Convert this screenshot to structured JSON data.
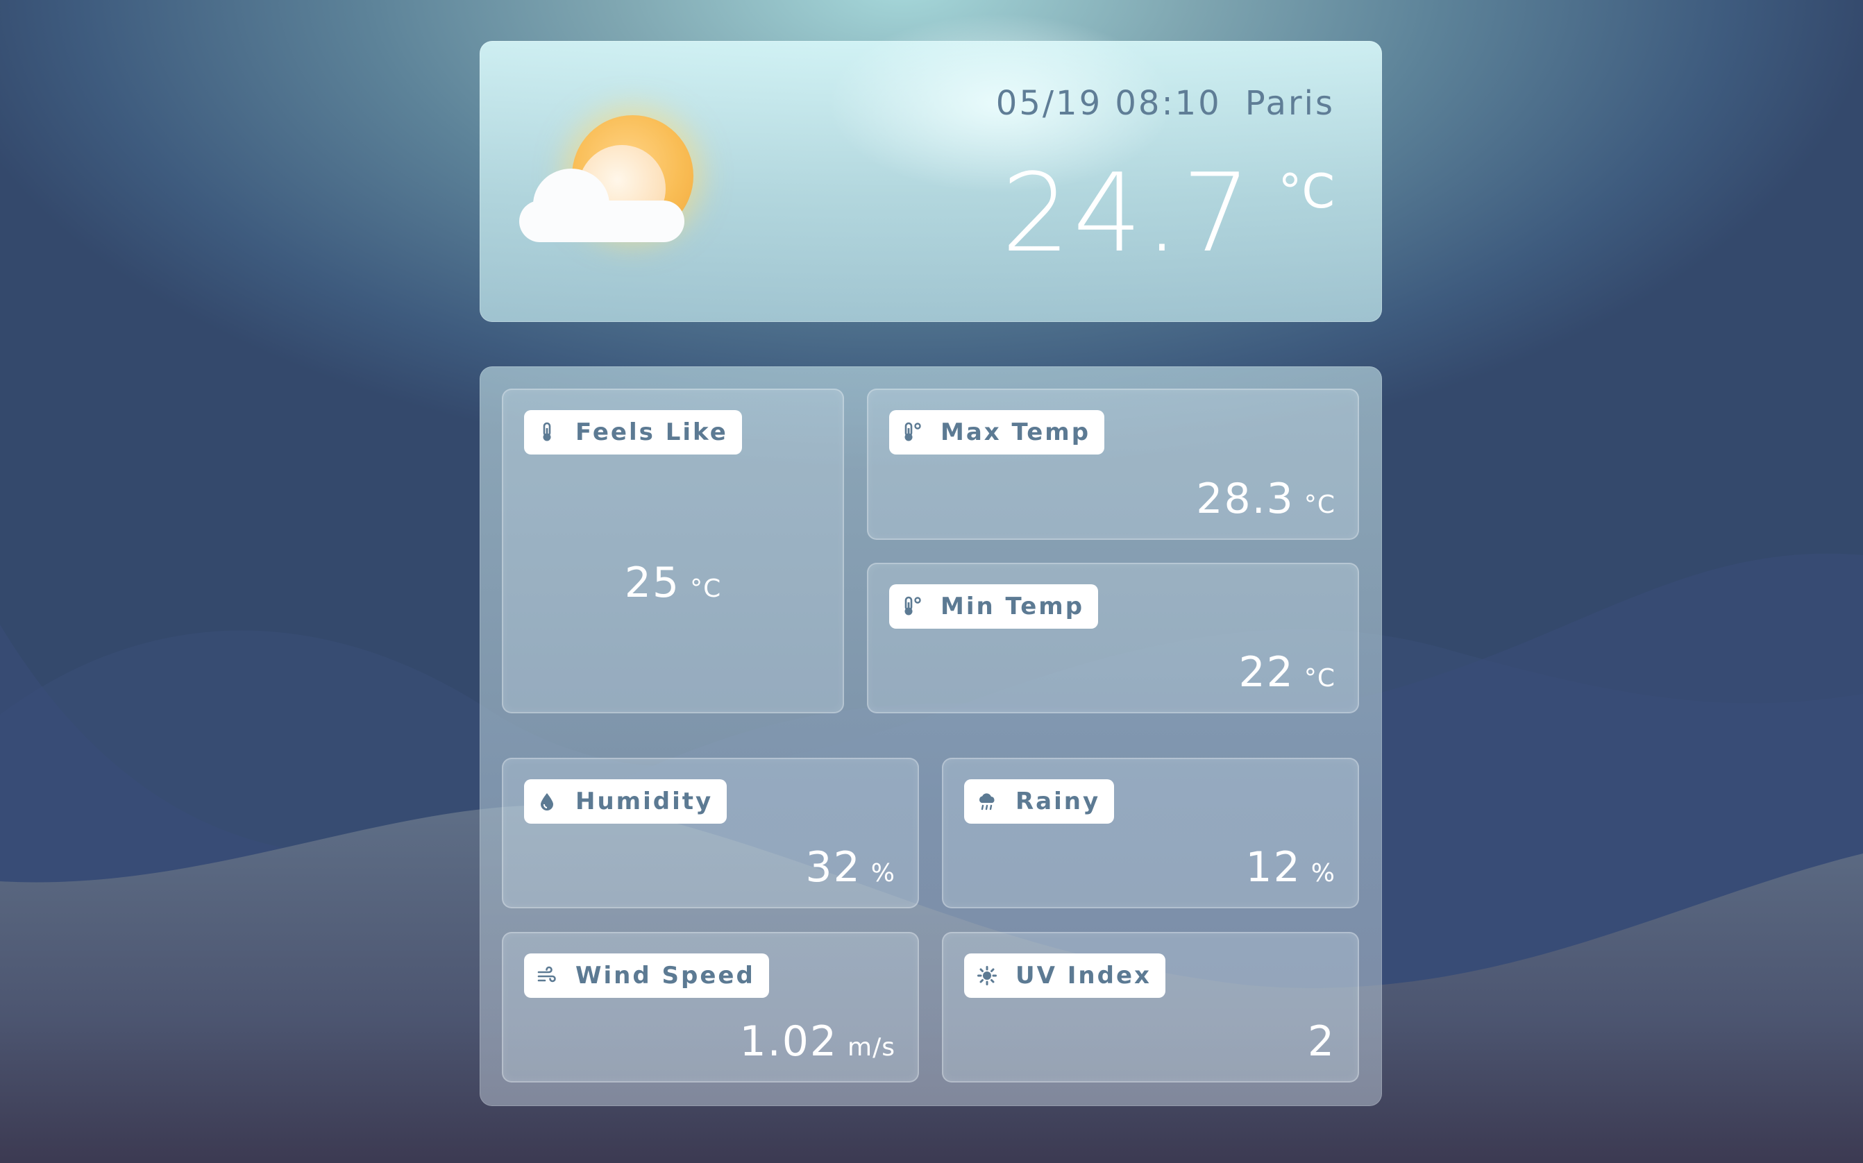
{
  "header": {
    "date_time": "05/19 08:10",
    "city": "Paris",
    "temperature": "24.7",
    "temperature_unit": "°C",
    "weather_icon": "partly-cloudy-icon"
  },
  "details": {
    "feels_like": {
      "label": "Feels Like",
      "value": "25",
      "unit": "°C",
      "icon": "thermometer-icon"
    },
    "max_temp": {
      "label": "Max Temp",
      "value": "28.3",
      "unit": "°C",
      "icon": "thermometer-degree-icon"
    },
    "min_temp": {
      "label": "Min Temp",
      "value": "22",
      "unit": "°C",
      "icon": "thermometer-degree-icon"
    },
    "humidity": {
      "label": "Humidity",
      "value": "32",
      "unit": "%",
      "icon": "droplet-icon"
    },
    "rainy": {
      "label": "Rainy",
      "value": "12",
      "unit": "%",
      "icon": "rain-cloud-icon"
    },
    "wind_speed": {
      "label": "Wind Speed",
      "value": "1.02",
      "unit": "m/s",
      "icon": "wind-icon"
    },
    "uv_index": {
      "label": "UV Index",
      "value": "2",
      "icon": "sun-gear-icon"
    }
  },
  "colors": {
    "chip_text": "#5c7a93",
    "value_text": "#ffffff",
    "sun": "#f9bd55"
  }
}
